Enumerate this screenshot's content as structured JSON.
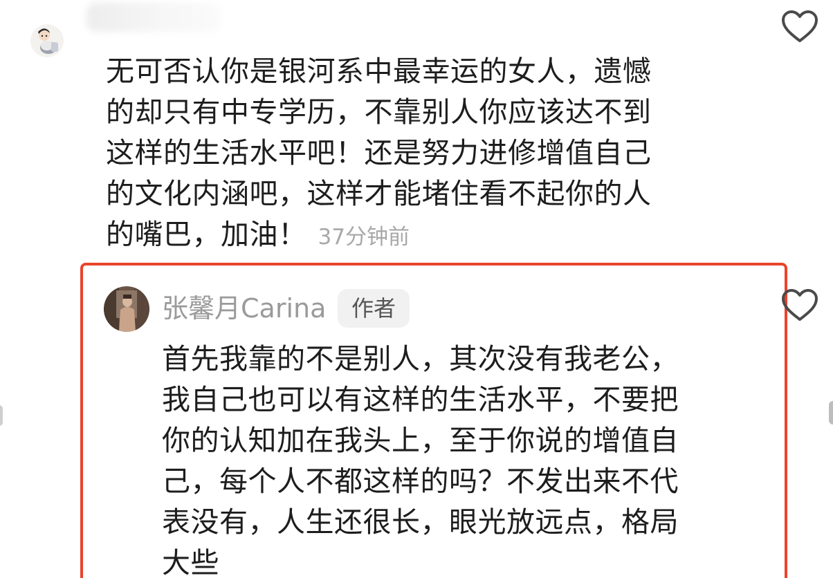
{
  "colors": {
    "text": "#1d1d1d",
    "muted": "#a8a8a8",
    "highlight_border": "#e8442c",
    "badge_bg": "#f1f1f1"
  },
  "top_comment": {
    "avatar_icon": "user-avatar",
    "like_icon": "heart-outline-icon",
    "lines": [
      "无可否认你是银河系中最幸运的女人，遗憾",
      "的却只有中专学历，不靠别人你应该达不到",
      "这样的生活水平吧！还是努力进修增值自己",
      "的文化内涵吧，这样才能堵住看不起你的人",
      "的嘴巴，加油！"
    ],
    "time": "37分钟前"
  },
  "reply": {
    "avatar_icon": "author-avatar",
    "like_icon": "heart-outline-icon",
    "username": "张馨月Carina",
    "badge": "作者",
    "lines": [
      "首先我靠的不是别人，其次没有我老公，",
      "我自己也可以有这样的生活水平，不要把",
      "你的认知加在我头上，至于你说的增值自",
      "己，每个人不都这样的吗？不发出来不代",
      "表没有，人生还很长，眼光放远点，格局",
      "大些"
    ]
  }
}
